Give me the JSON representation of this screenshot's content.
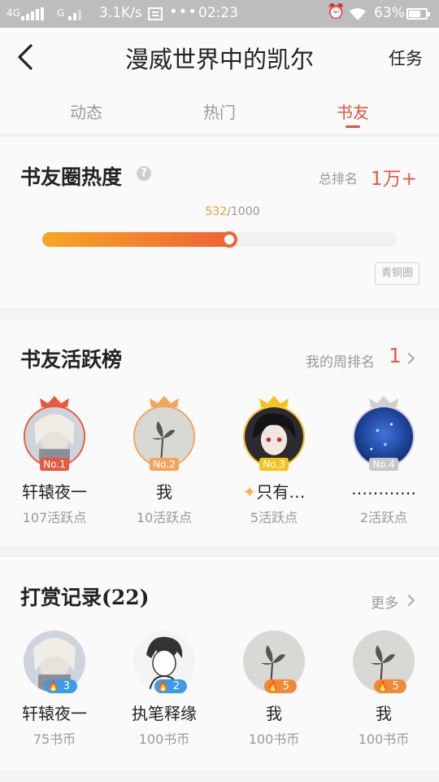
{
  "status_bar": {
    "network_1": "4G",
    "network_2": "G",
    "speed": "3.1K/s",
    "dots": "•••",
    "time": "02:23",
    "battery": "63%"
  },
  "header": {
    "title": "漫威世界中的凯尔",
    "task_label": "任务",
    "tabs": [
      {
        "label": "动态"
      },
      {
        "label": "热门"
      },
      {
        "label": "书友"
      }
    ],
    "active_tab": "书友"
  },
  "heat": {
    "title": "书友圈热度",
    "help_icon": "question-icon",
    "total_rank_label": "总排名",
    "total_rank_value": "1万+",
    "progress_current": "532",
    "progress_max": "/1000",
    "progress_fraction": 0.532,
    "level_badge": "青铜圈"
  },
  "active_board": {
    "title": "书友活跃榜",
    "my_rank_label": "我的周排名",
    "my_rank_value": "1",
    "members": [
      {
        "rank": "No.1",
        "name": "轩辕夜一",
        "score": "107活跃点",
        "color": "#e65a40"
      },
      {
        "rank": "No.2",
        "name": "我",
        "score": "10活跃点",
        "color": "#f4a35a"
      },
      {
        "rank": "No.3",
        "name": "只有…",
        "score": "5活跃点",
        "color": "#f7c21c"
      },
      {
        "rank": "No.4",
        "name": "…………",
        "score": "2活跃点",
        "color": "#c8c8c8"
      }
    ]
  },
  "rewards": {
    "title": "打赏记录(22)",
    "more_label": "更多",
    "members": [
      {
        "level": "3",
        "name": "轩辕夜一",
        "amount": "75书币",
        "badge_color": "#3c9be8"
      },
      {
        "level": "2",
        "name": "执笔释缘",
        "amount": "100书币",
        "badge_color": "#3c9be8"
      },
      {
        "level": "5",
        "name": "我",
        "amount": "100书币",
        "badge_color": "#f08a34"
      },
      {
        "level": "5",
        "name": "我",
        "amount": "100书币",
        "badge_color": "#f08a34"
      }
    ]
  },
  "colors": {
    "accent": "#e65a40",
    "progress_start": "#f7a623",
    "progress_end": "#f06236"
  }
}
